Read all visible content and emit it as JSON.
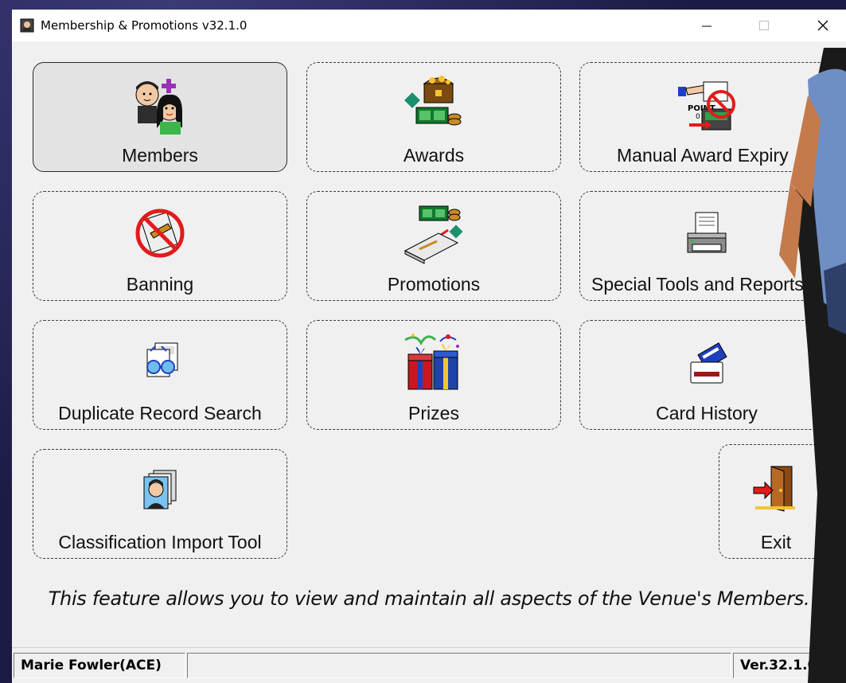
{
  "window": {
    "title": "Membership & Promotions v32.1.0",
    "controls": {
      "minimize": "—",
      "maximize": "☐",
      "close": "✕"
    }
  },
  "tiles": [
    {
      "id": "members",
      "label": "Members",
      "icon": "members-icon",
      "selected": true
    },
    {
      "id": "awards",
      "label": "Awards",
      "icon": "awards-icon"
    },
    {
      "id": "manual-award-expiry",
      "label": "Manual Award Expiry",
      "icon": "point-expiry-icon"
    },
    {
      "id": "banning",
      "label": "Banning",
      "icon": "banning-icon"
    },
    {
      "id": "promotions",
      "label": "Promotions",
      "icon": "promotions-icon"
    },
    {
      "id": "special-tools",
      "label": "Special Tools and Reports",
      "icon": "printer-icon"
    },
    {
      "id": "duplicate-record-search",
      "label": "Duplicate Record Search",
      "icon": "duplicate-search-icon"
    },
    {
      "id": "prizes",
      "label": "Prizes",
      "icon": "gift-icon"
    },
    {
      "id": "card-history",
      "label": "Card History",
      "icon": "card-icon"
    },
    {
      "id": "classification-import-tool",
      "label": "Classification Import Tool",
      "icon": "portrait-icon"
    },
    {
      "id": "exit",
      "label": "Exit",
      "icon": "exit-door-icon"
    }
  ],
  "description": "This feature allows you to view and maintain all aspects of the Venue's Members.",
  "status": {
    "user": "Marie Fowler(ACE)",
    "middle": "",
    "version": "Ver.32.1.0"
  }
}
